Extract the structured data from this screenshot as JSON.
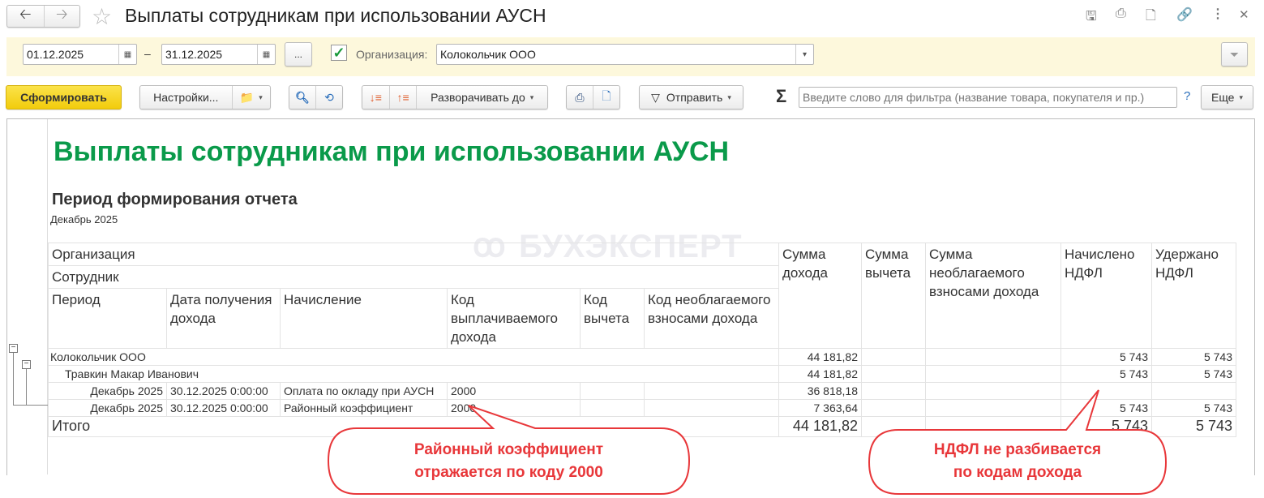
{
  "window": {
    "title": "Выплаты сотрудникам при использовании АУСН"
  },
  "filters": {
    "date_from": "01.12.2025",
    "date_sep": "–",
    "date_to": "31.12.2025",
    "more_label": "...",
    "org_label": "Организация:",
    "org_value": "Колокольчик ООО",
    "org_checked": true
  },
  "toolbar": {
    "generate": "Сформировать",
    "settings": "Настройки...",
    "expand_to": "Разворачивать до",
    "send": "Отправить",
    "sigma": "Σ",
    "search_placeholder": "Введите слово для фильтра (название товара, покупателя и пр.)",
    "help": "?",
    "more": "Еще"
  },
  "report": {
    "title": "Выплаты сотрудникам при использовании АУСН",
    "period_heading": "Период формирования отчета",
    "period_value": "Декабрь 2025",
    "watermark": "БУХЭКСПЕРТ",
    "headers": {
      "org": "Организация",
      "employee": "Сотрудник",
      "period": "Период",
      "date": "Дата получения дохода",
      "accrual": "Начисление",
      "income_code": "Код выплачиваемого дохода",
      "deduction_code": "Код вычета",
      "nontaxable_code": "Код необлагаемого взносами дохода",
      "income_sum": "Сумма дохода",
      "deduction_sum": "Сумма вычета",
      "nontaxable_sum": "Сумма необлагаемого взносами дохода",
      "ndfl_accrued": "Начислено НДФЛ",
      "ndfl_withheld": "Удержано НДФЛ"
    },
    "org_row": {
      "name": "Колокольчик ООО",
      "income": "44 181,82",
      "accrued": "5 743",
      "withheld": "5 743"
    },
    "employee_row": {
      "name": "Травкин Макар Иванович",
      "income": "44 181,82",
      "accrued": "5 743",
      "withheld": "5 743"
    },
    "rows": [
      {
        "period": "Декабрь 2025",
        "date": "30.12.2025 0:00:00",
        "accrual": "Оплата по окладу при АУСН",
        "code": "2000",
        "income": "36 818,18",
        "accrued": "",
        "withheld": ""
      },
      {
        "period": "Декабрь 2025",
        "date": "30.12.2025 0:00:00",
        "accrual": "Районный коэффициент",
        "code": "2000",
        "income": "7 363,64",
        "accrued": "5 743",
        "withheld": "5 743"
      }
    ],
    "total": {
      "label": "Итого",
      "income": "44 181,82",
      "accrued": "5 743",
      "withheld": "5 743"
    }
  },
  "callouts": {
    "left": [
      "Районный коэффициент",
      "отражается по коду 2000"
    ],
    "right": [
      "НДФЛ не разбивается",
      "по кодам дохода"
    ]
  },
  "colors": {
    "title_green": "#0a9a4a",
    "generate_yellow": "#f5d313",
    "filter_bg": "#fdf8dc",
    "callout_red": "#e8373a"
  }
}
